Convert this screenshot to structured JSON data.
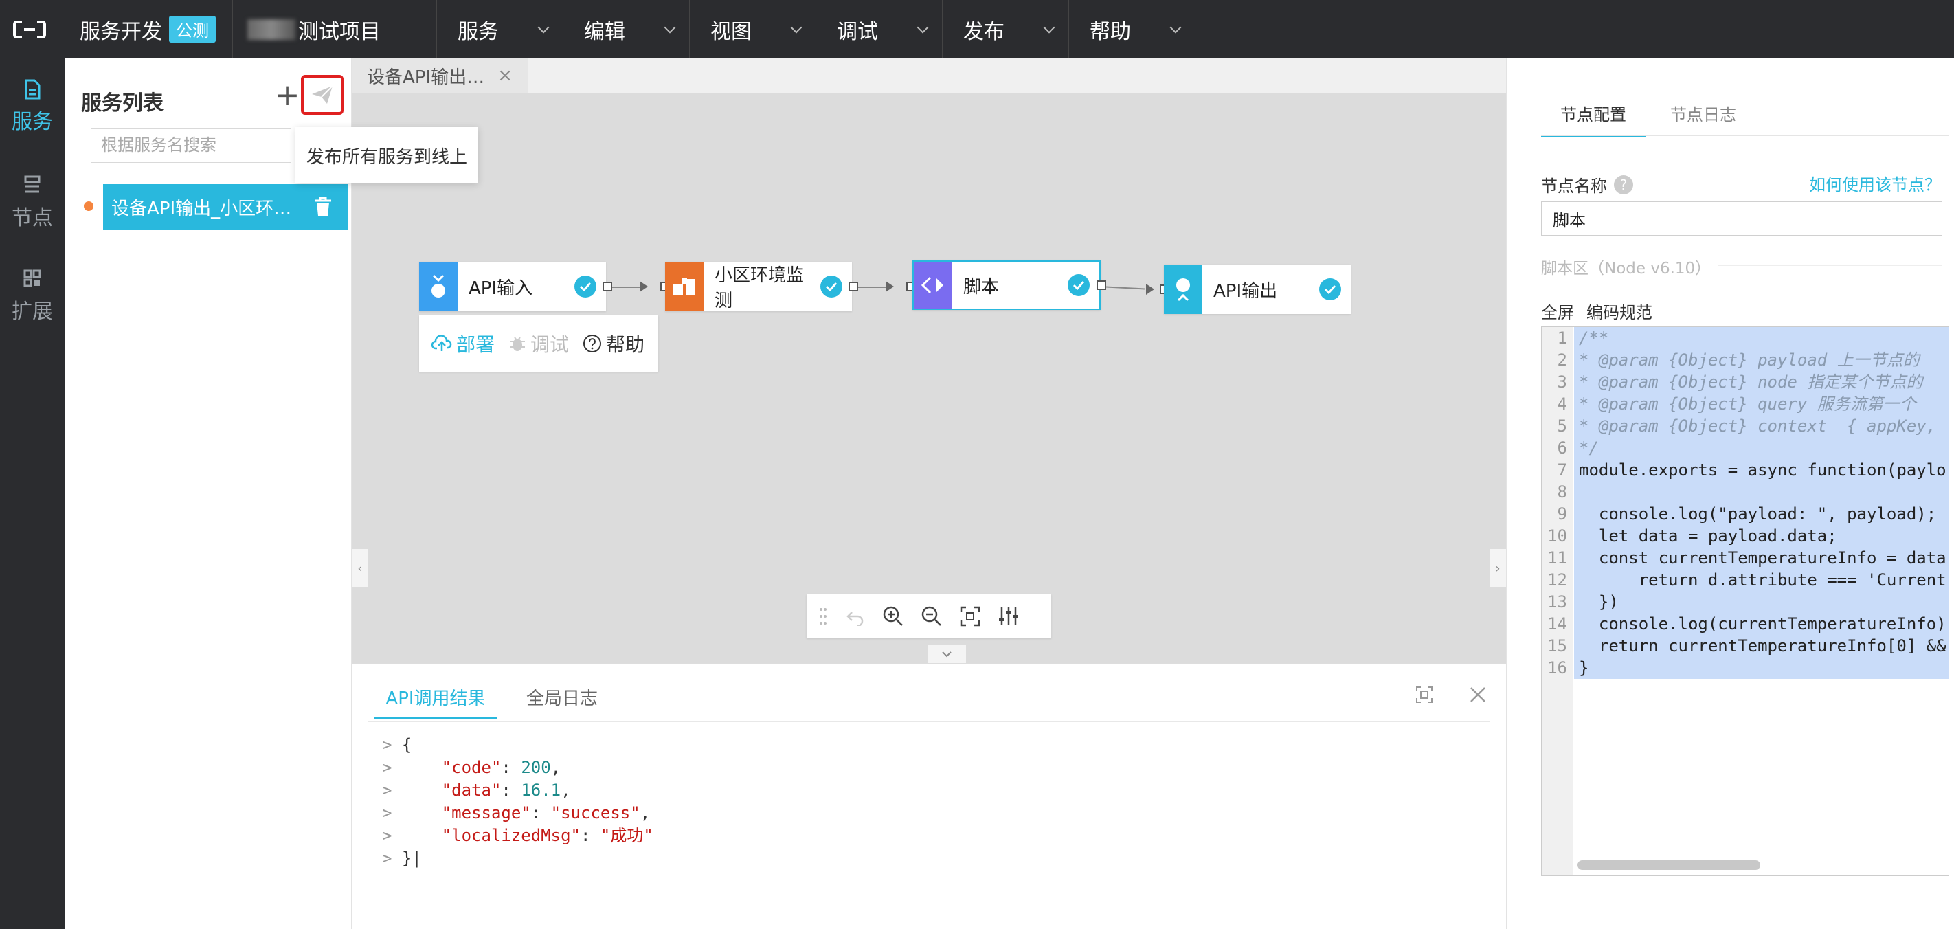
{
  "topbar": {
    "brand": "服务开发",
    "brand_tag": "公测",
    "project": "测试项目",
    "menus": [
      "服务",
      "编辑",
      "视图",
      "调试",
      "发布",
      "帮助"
    ]
  },
  "leftnav": {
    "items": [
      {
        "label": "服务",
        "active": true
      },
      {
        "label": "节点",
        "active": false
      },
      {
        "label": "扩展",
        "active": false
      }
    ]
  },
  "service_panel": {
    "title": "服务列表",
    "add": "+",
    "search_placeholder": "根据服务名搜索",
    "tooltip": "发布所有服务到线上",
    "items": [
      {
        "label": "设备API输出_小区环…"
      }
    ]
  },
  "editor_tab": {
    "label": "设备API输出…",
    "close": "×"
  },
  "flow": {
    "nodes": [
      {
        "label": "API输入",
        "color": "#3aa0f0"
      },
      {
        "label": "小区环境监测",
        "color": "#e8702a"
      },
      {
        "label": "脚本",
        "color": "#7a6cf0"
      },
      {
        "label": "API输出",
        "color": "#29b8dd"
      }
    ],
    "actions": {
      "deploy": "部署",
      "debug": "调试",
      "help": "帮助"
    }
  },
  "bottom": {
    "tabs": [
      "API调用结果",
      "全局日志"
    ],
    "result": {
      "open": "{",
      "lines": [
        {
          "key": "\"code\"",
          "value": "200",
          "type": "num"
        },
        {
          "key": "\"data\"",
          "value": "16.1",
          "type": "num"
        },
        {
          "key": "\"message\"",
          "value": "\"success\"",
          "type": "str"
        },
        {
          "key": "\"localizedMsg\"",
          "value": "\"成功\"",
          "type": "str"
        }
      ],
      "close": "}"
    }
  },
  "right": {
    "tabs": [
      "节点配置",
      "节点日志"
    ],
    "name_label": "节点名称",
    "help_link": "如何使用该节点？",
    "name_value": "脚本",
    "script_area": "脚本区（Node v6.10）",
    "fullscreen": "全屏",
    "coding_std": "编码规范",
    "code_lines": [
      "/**",
      "* @param {Object} payload 上一节点的",
      "* @param {Object} node 指定某个节点的",
      "* @param {Object} query 服务流第一个",
      "* @param {Object} context  { appKey,",
      "*/",
      "module.exports = async function(paylo",
      "",
      "  console.log(\"payload: \", payload);",
      "  let data = payload.data;",
      "  const currentTemperatureInfo = data",
      "      return d.attribute === 'Current",
      "  })",
      "  console.log(currentTemperatureInfo)",
      "  return currentTemperatureInfo[0] &&",
      "}"
    ]
  }
}
